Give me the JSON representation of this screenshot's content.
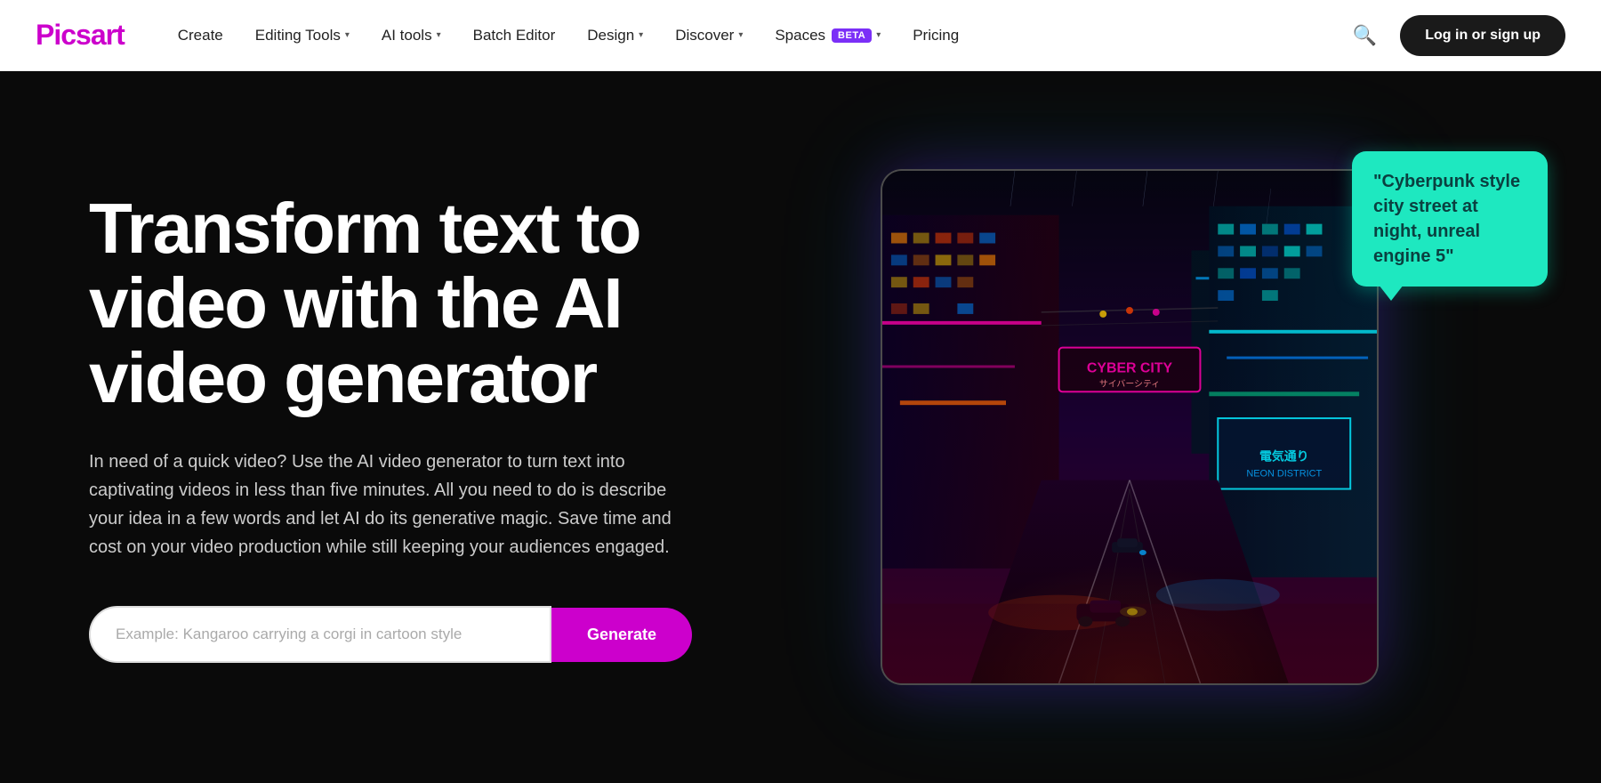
{
  "brand": {
    "name": "Picsart",
    "color": "#CC00CC"
  },
  "navbar": {
    "links": [
      {
        "id": "create",
        "label": "Create",
        "has_dropdown": false
      },
      {
        "id": "editing-tools",
        "label": "Editing Tools",
        "has_dropdown": true
      },
      {
        "id": "ai-tools",
        "label": "AI tools",
        "has_dropdown": true
      },
      {
        "id": "batch-editor",
        "label": "Batch Editor",
        "has_dropdown": false
      },
      {
        "id": "design",
        "label": "Design",
        "has_dropdown": true
      },
      {
        "id": "discover",
        "label": "Discover",
        "has_dropdown": true
      },
      {
        "id": "spaces",
        "label": "Spaces",
        "has_beta": true,
        "has_dropdown": true
      },
      {
        "id": "pricing",
        "label": "Pricing",
        "has_dropdown": false
      }
    ],
    "login_label": "Log in or sign up"
  },
  "hero": {
    "title": "Transform text to video with the AI video generator",
    "description": "In need of a quick video? Use the AI video generator to turn text into captivating videos in less than five minutes. All you need to do is describe your idea in a few words and let AI do its generative magic. Save time and cost on your video production while still keeping your audiences engaged.",
    "input_placeholder": "Example: Kangaroo carrying a corgi in cartoon style",
    "generate_button": "Generate",
    "speech_bubble_text": "\"Cyberpunk style city street at night, unreal engine 5\""
  }
}
